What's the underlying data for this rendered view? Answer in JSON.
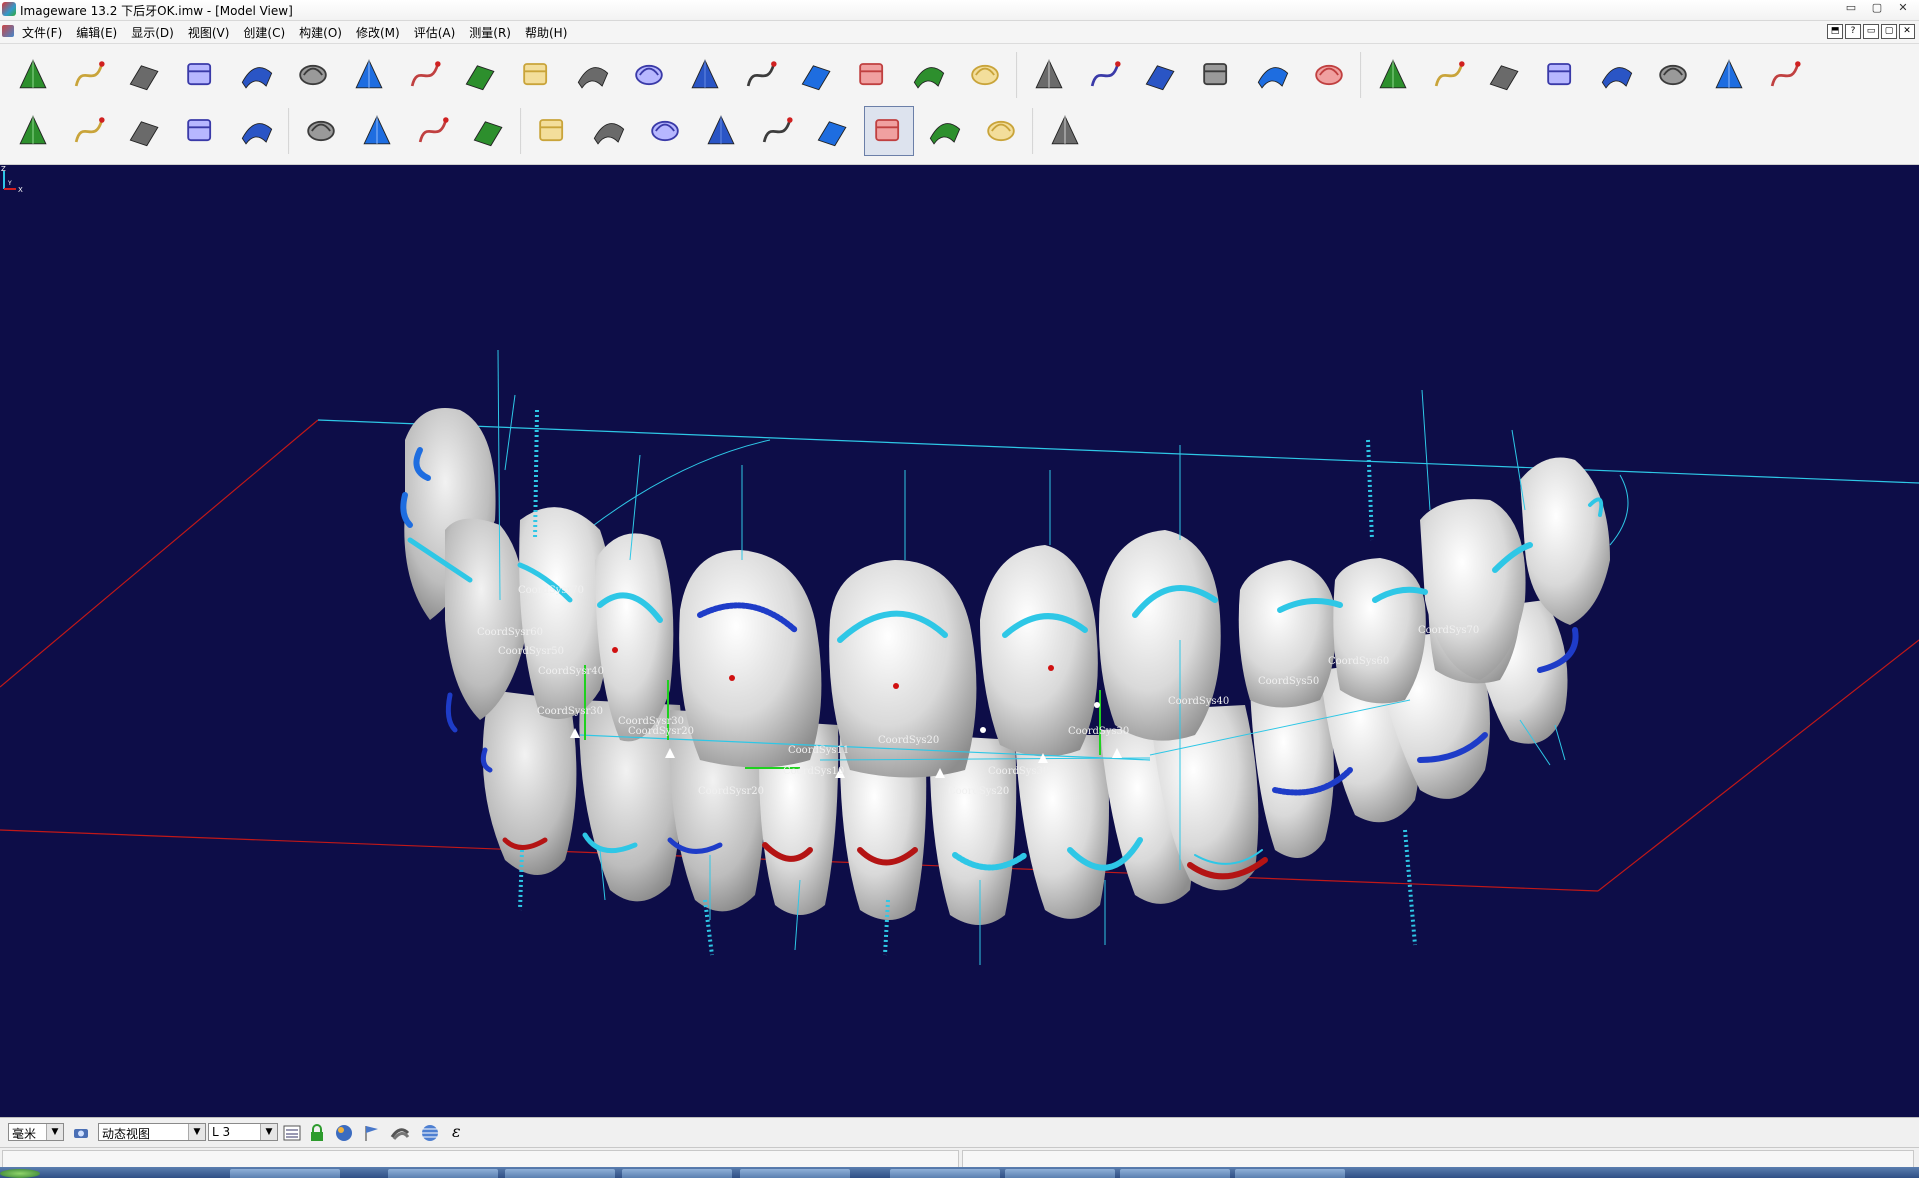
{
  "window": {
    "title": "Imageware 13.2   下后牙OK.imw - [Model View]",
    "controls": [
      "▭",
      "▢",
      "✕"
    ]
  },
  "menubar": {
    "items": [
      "文件(F)",
      "编辑(E)",
      "显示(D)",
      "视图(V)",
      "创建(C)",
      "构建(O)",
      "修改(M)",
      "评估(A)",
      "测量(R)",
      "帮助(H)"
    ],
    "mdi_controls": [
      "⬒",
      "?",
      "▭",
      "▢",
      "✕"
    ]
  },
  "toolbar": {
    "row1_icons": [
      "open-file-icon",
      "edit-points-icon",
      "scan-inspect-icon",
      "plane-view-icon",
      "cube-view-icon",
      "layers-icon",
      "cone-surface-icon",
      "shell-icon",
      "blue-surface-icon",
      "blue-surface-2-icon",
      "cylinder-surface-icon",
      "color-patch-icon",
      "curved-surface-icon",
      "curved-surface-2-icon",
      "stack-surface-icon",
      "extrude-surface-icon",
      "ruled-surface-icon",
      "pyramid-icon",
      "wire-box-icon",
      "wire-object-icon",
      "control-net-icon",
      "box-object-icon",
      "plane-cross-icon",
      "coordinate-axes-icon",
      "green-curve-surface-icon",
      "blend-icon",
      "offset-surface-icon",
      "normal-arrows-icon",
      "flat-plate-icon",
      "cylinder-bars-icon",
      "probe-icon",
      "pen-tool-icon"
    ],
    "row2_icons": [
      "gauge-icon",
      "section-cut-icon",
      "stripes-icon",
      "stripes-2-icon",
      "color-map-icon",
      "cloud-icon",
      "curve-icon",
      "surface-patch-icon",
      "arc-fan-icon",
      "grid-points-icon",
      "lightning-icon",
      "curve-lightning-icon",
      "points-line-icon",
      "circle-point-icon",
      "curve-lightning-2-icon",
      "surface-lightning-icon",
      "cross-tool-icon",
      "prohibit-icon",
      "palette-icon"
    ],
    "active_icon": "surface-lightning-icon"
  },
  "viewport": {
    "background": "#0d0d48",
    "axis_triad": {
      "x": "X",
      "y": "Y",
      "z": "Z"
    },
    "upper_labels": [
      "CoordSysr70",
      "CoordSysr60",
      "CoordSysr50",
      "CoordSysr40",
      "CoordSysr30",
      "CoordSysr30",
      "CoordSysr20",
      "CoordSys11",
      "CoordSys20",
      "CoordSys30",
      "CoordSys40",
      "CoordSys50",
      "CoordSys60",
      "CoordSys70"
    ],
    "lower_labels": [
      "CoordSysr20",
      "CoordSys10",
      "CoordSys20",
      "CoordSys30"
    ]
  },
  "statusbar": {
    "unit": "毫米",
    "view_mode": "动态视图",
    "layer": "L 3",
    "epsilon": "ε"
  }
}
